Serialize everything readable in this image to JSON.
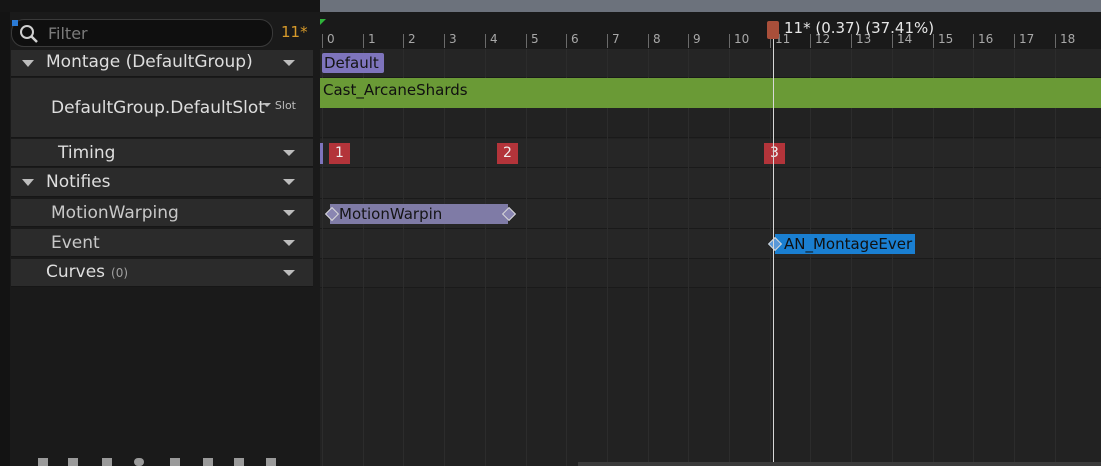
{
  "filter": {
    "placeholder": "Filter",
    "frame_count": "11*"
  },
  "tracks": {
    "montage": {
      "label": "Montage (DefaultGroup)"
    },
    "slot": {
      "label": "DefaultGroup.DefaultSlot",
      "slot_label": "Slot"
    },
    "timing": {
      "label": "Timing"
    },
    "notifies": {
      "label": "Notifies"
    },
    "motion_warping": {
      "label": "MotionWarping"
    },
    "event": {
      "label": "Event"
    },
    "curves": {
      "label": "Curves",
      "count": "(0)"
    }
  },
  "timeline": {
    "ruler_labels": [
      "0",
      "1",
      "2",
      "3",
      "4",
      "5",
      "6",
      "7",
      "8",
      "9",
      "10",
      "11",
      "12",
      "13",
      "14",
      "15",
      "16",
      "17",
      "18"
    ],
    "playhead_label": "11* (0.37) (37.41%)",
    "section_label": "Default",
    "anim_segment": "Cast_ArcaneShards",
    "timing_markers": [
      "1",
      "2",
      "3"
    ],
    "notify_motion_warping": "MotionWarpin",
    "notify_event": "AN_MontageEver"
  },
  "colors": {
    "accent_frame": "#d79a2a",
    "section": "#7e74bc",
    "anim_segment": "#6a9a36",
    "timing_marker": "#b3343a",
    "event_notify": "#1a7fd1"
  }
}
